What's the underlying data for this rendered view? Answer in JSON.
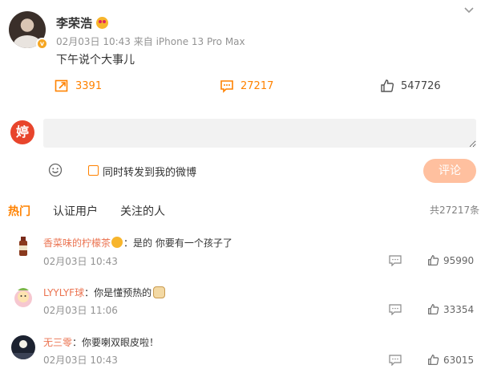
{
  "post": {
    "author": "李荣浩",
    "meta": "02月03日 10:43  来自 iPhone 13 Pro Max",
    "text": "下午说个大事儿",
    "reposts": "3391",
    "comments": "27217",
    "likes": "547726",
    "avatar_badge": "v"
  },
  "composer": {
    "my_avatar_glyph": "婷",
    "repost_checkbox_label": "同时转发到我的微博",
    "submit_label": "评论"
  },
  "tabs": {
    "items": [
      "热门",
      "认证用户",
      "关注的人"
    ],
    "total": "共27217条"
  },
  "comments": [
    {
      "nick": "香菜味的柠檬茶",
      "text": "：是的 你要有一个孩子了",
      "time": "02月03日 10:43",
      "likes": "95990",
      "emoji": "heart-eyes-emoji"
    },
    {
      "nick": "LYYLYF球",
      "text": "：你是懂预热的",
      "time": "02月03日 11:06",
      "likes": "33354",
      "emoji": "doge-emoji"
    },
    {
      "nick": "无三零",
      "text": "：你要喇双眼皮啦！",
      "time": "02月03日 10:43",
      "likes": "63015"
    }
  ],
  "colors": {
    "accent": "#ff8200",
    "nick": "#eb7350",
    "button_disabled": "#ffc09f",
    "input_bg": "#f2f2f2"
  }
}
